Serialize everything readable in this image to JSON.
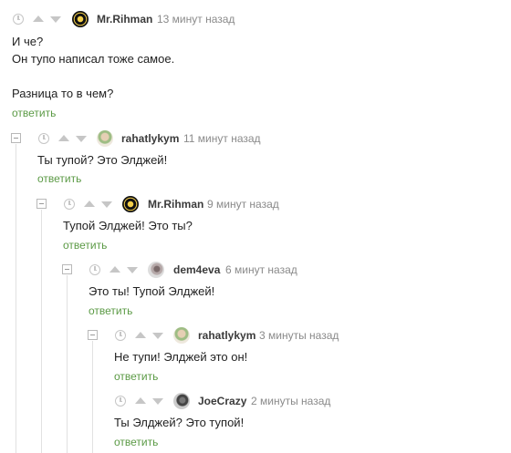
{
  "comments": [
    {
      "user": "Mr.Rihman",
      "time": "13 минут назад",
      "lines": [
        "И че?",
        "Он тупо написал тоже самое.",
        "",
        "Разница то в чем?"
      ],
      "reply": "ответить"
    },
    {
      "user": "rahatlykym",
      "time": "11 минут назад",
      "lines": [
        "Ты тупой? Это Элджей!"
      ],
      "reply": "ответить"
    },
    {
      "user": "Mr.Rihman",
      "time": "9 минут назад",
      "lines": [
        "Тупой Элджей! Это ты?"
      ],
      "reply": "ответить"
    },
    {
      "user": "dem4eva",
      "time": "6 минут назад",
      "lines": [
        "Это ты! Тупой Элджей!"
      ],
      "reply": "ответить"
    },
    {
      "user": "rahatlykym",
      "time": "3 минуты назад",
      "lines": [
        "Не тупи! Элджей это он!"
      ],
      "reply": "ответить"
    },
    {
      "user": "JoeCrazy",
      "time": "2 минуты назад",
      "lines": [
        "Ты Элджей? Это тупой!"
      ],
      "reply": "ответить"
    }
  ],
  "icons": {
    "clock": "clock-icon",
    "upvote": "upvote-icon",
    "downvote": "downvote-icon",
    "collapse": "collapse-thread-icon"
  },
  "colors": {
    "reply_link": "#5b9a45",
    "meta_text": "#8a8a8a",
    "icon_grey": "#c6c6c6"
  }
}
